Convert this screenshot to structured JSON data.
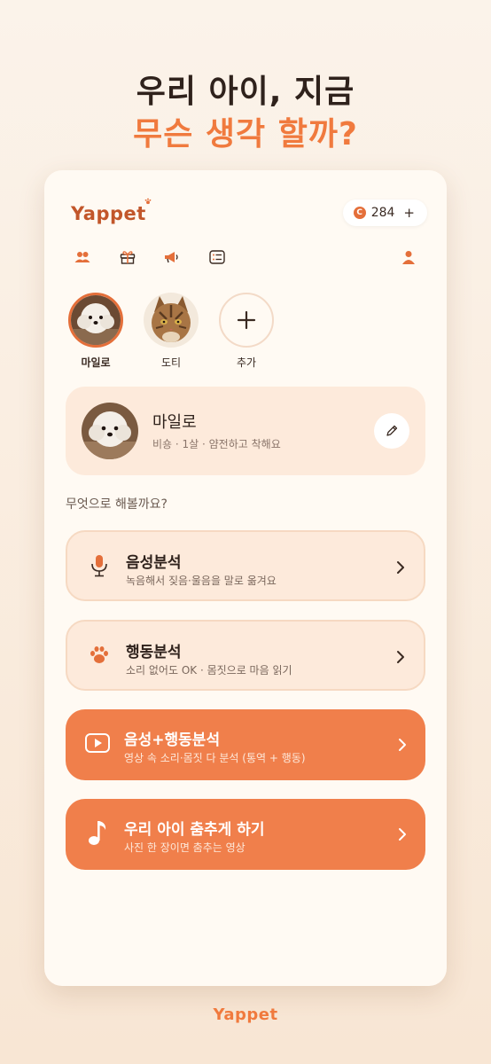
{
  "headline": {
    "line1": "우리 아이, 지금",
    "line2": "무슨 생각 할까?"
  },
  "app": {
    "logo": "Yappet",
    "coin_symbol": "C",
    "coin_count": "284",
    "coin_add": "+"
  },
  "nav_icons": [
    "people-icon",
    "gift-icon",
    "megaphone-icon",
    "list-icon",
    "user-icon"
  ],
  "pets": [
    {
      "name": "마일로",
      "active": true
    },
    {
      "name": "도티",
      "active": false
    },
    {
      "name": "추가",
      "active": false
    }
  ],
  "profile": {
    "name": "마일로",
    "desc": "비숑 · 1살 · 얌전하고 착해요"
  },
  "section_title": "무엇으로 해볼까요?",
  "menu": [
    {
      "title": "음성분석",
      "subtitle": "녹음해서 짖음·울음을 말로 옮겨요",
      "icon": "microphone-icon"
    },
    {
      "title": "행동분석",
      "subtitle": "소리 없어도 OK · 몸짓으로 마음 읽기",
      "icon": "paw-icon"
    },
    {
      "title": "음성+행동분석",
      "subtitle": "영상 속 소리·몸짓 다 분석 (통역 + 행동)",
      "icon": "video-play-icon"
    },
    {
      "title": "우리 아이 춤추게 하기",
      "subtitle": "사진 한 장이면 춤추는 영상",
      "icon": "music-note-icon"
    }
  ],
  "footer": {
    "logo": "Yappet"
  },
  "colors": {
    "accent": "#f07a3e",
    "brand": "#c2562a",
    "card_light": "#fdeadb",
    "background": "#fffaf3"
  }
}
